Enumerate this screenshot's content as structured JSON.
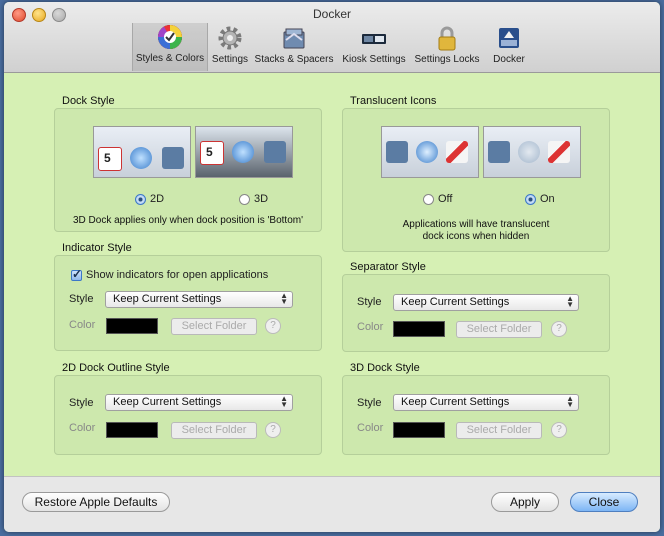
{
  "window": {
    "title": "Docker"
  },
  "tabs": [
    {
      "label": "Styles & Colors",
      "icon": "color-wheel-icon"
    },
    {
      "label": "Settings",
      "icon": "gear-icon"
    },
    {
      "label": "Stacks & Spacers",
      "icon": "stack-icon"
    },
    {
      "label": "Kiosk Settings",
      "icon": "kiosk-icon"
    },
    {
      "label": "Settings Locks",
      "icon": "padlock-icon"
    },
    {
      "label": "Docker",
      "icon": "docker-app-icon"
    }
  ],
  "dock_style": {
    "title": "Dock Style",
    "option_2d": "2D",
    "option_3d": "3D",
    "selected": "2D",
    "calendar_day": "5",
    "note": "3D Dock applies only when dock position is 'Bottom'"
  },
  "translucent_icons": {
    "title": "Translucent Icons",
    "option_off": "Off",
    "option_on": "On",
    "selected": "On",
    "note_line1": "Applications will have translucent",
    "note_line2": "dock icons when hidden"
  },
  "indicator_style": {
    "title": "Indicator Style",
    "checkbox_label": "Show indicators for open applications",
    "checked": true,
    "style_label": "Style",
    "style_value": "Keep Current Settings",
    "color_label": "Color",
    "select_folder": "Select Folder",
    "help": "?"
  },
  "separator_style": {
    "title": "Separator Style",
    "style_label": "Style",
    "style_value": "Keep Current Settings",
    "color_label": "Color",
    "select_folder": "Select Folder",
    "help": "?"
  },
  "outline_style": {
    "title": "2D Dock Outline Style",
    "style_label": "Style",
    "style_value": "Keep Current Settings",
    "color_label": "Color",
    "select_folder": "Select Folder",
    "help": "?"
  },
  "dock3d_style": {
    "title": "3D Dock Style",
    "style_label": "Style",
    "style_value": "Keep Current Settings",
    "color_label": "Color",
    "select_folder": "Select Folder",
    "help": "?"
  },
  "footer": {
    "restore": "Restore Apple Defaults",
    "apply": "Apply",
    "close": "Close"
  },
  "colors": {
    "panel_bg": "#d6f0b4",
    "group_bg": "#cde8ad",
    "accent": "#7db5f5",
    "swatch": "#000000"
  }
}
